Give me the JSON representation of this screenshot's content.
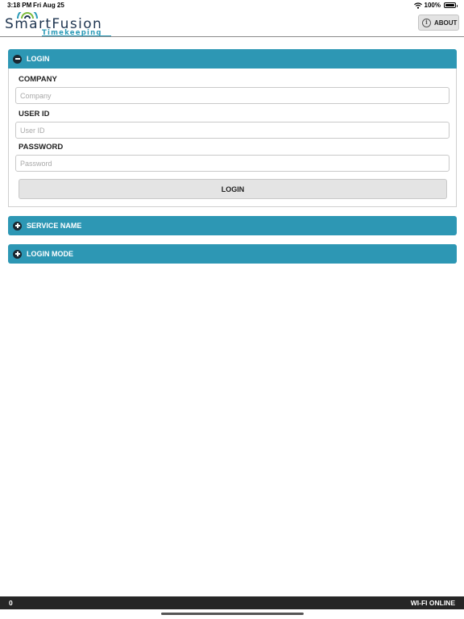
{
  "status_bar": {
    "time": "3:18 PM",
    "date": "Fri Aug 25",
    "battery": "100%",
    "icons": [
      "wifi-icon",
      "battery-icon"
    ]
  },
  "header": {
    "logo_name": "SmartFusion",
    "logo_sub": "Timekeeping",
    "about_label": "ABOUT",
    "about_icon": "info-icon"
  },
  "login_section": {
    "title": "LOGIN",
    "state": "expanded",
    "icon": "minus-circle-icon",
    "company_label": "COMPANY",
    "company_placeholder": "Company",
    "company_value": "",
    "userid_label": "USER ID",
    "userid_placeholder": "User ID",
    "userid_value": "",
    "password_label": "PASSWORD",
    "password_placeholder": "Password",
    "password_value": "",
    "login_button": "LOGIN"
  },
  "service_section": {
    "title": "SERVICE NAME",
    "state": "collapsed",
    "icon": "plus-circle-icon"
  },
  "login_mode_section": {
    "title": "LOGIN MODE",
    "state": "collapsed",
    "icon": "plus-circle-icon"
  },
  "footer": {
    "count": "0",
    "connection_status": "WI-FI ONLINE"
  },
  "colors": {
    "accent": "#2d97b4",
    "footer_bg": "#262626",
    "icon_dark": "#1b2731"
  }
}
